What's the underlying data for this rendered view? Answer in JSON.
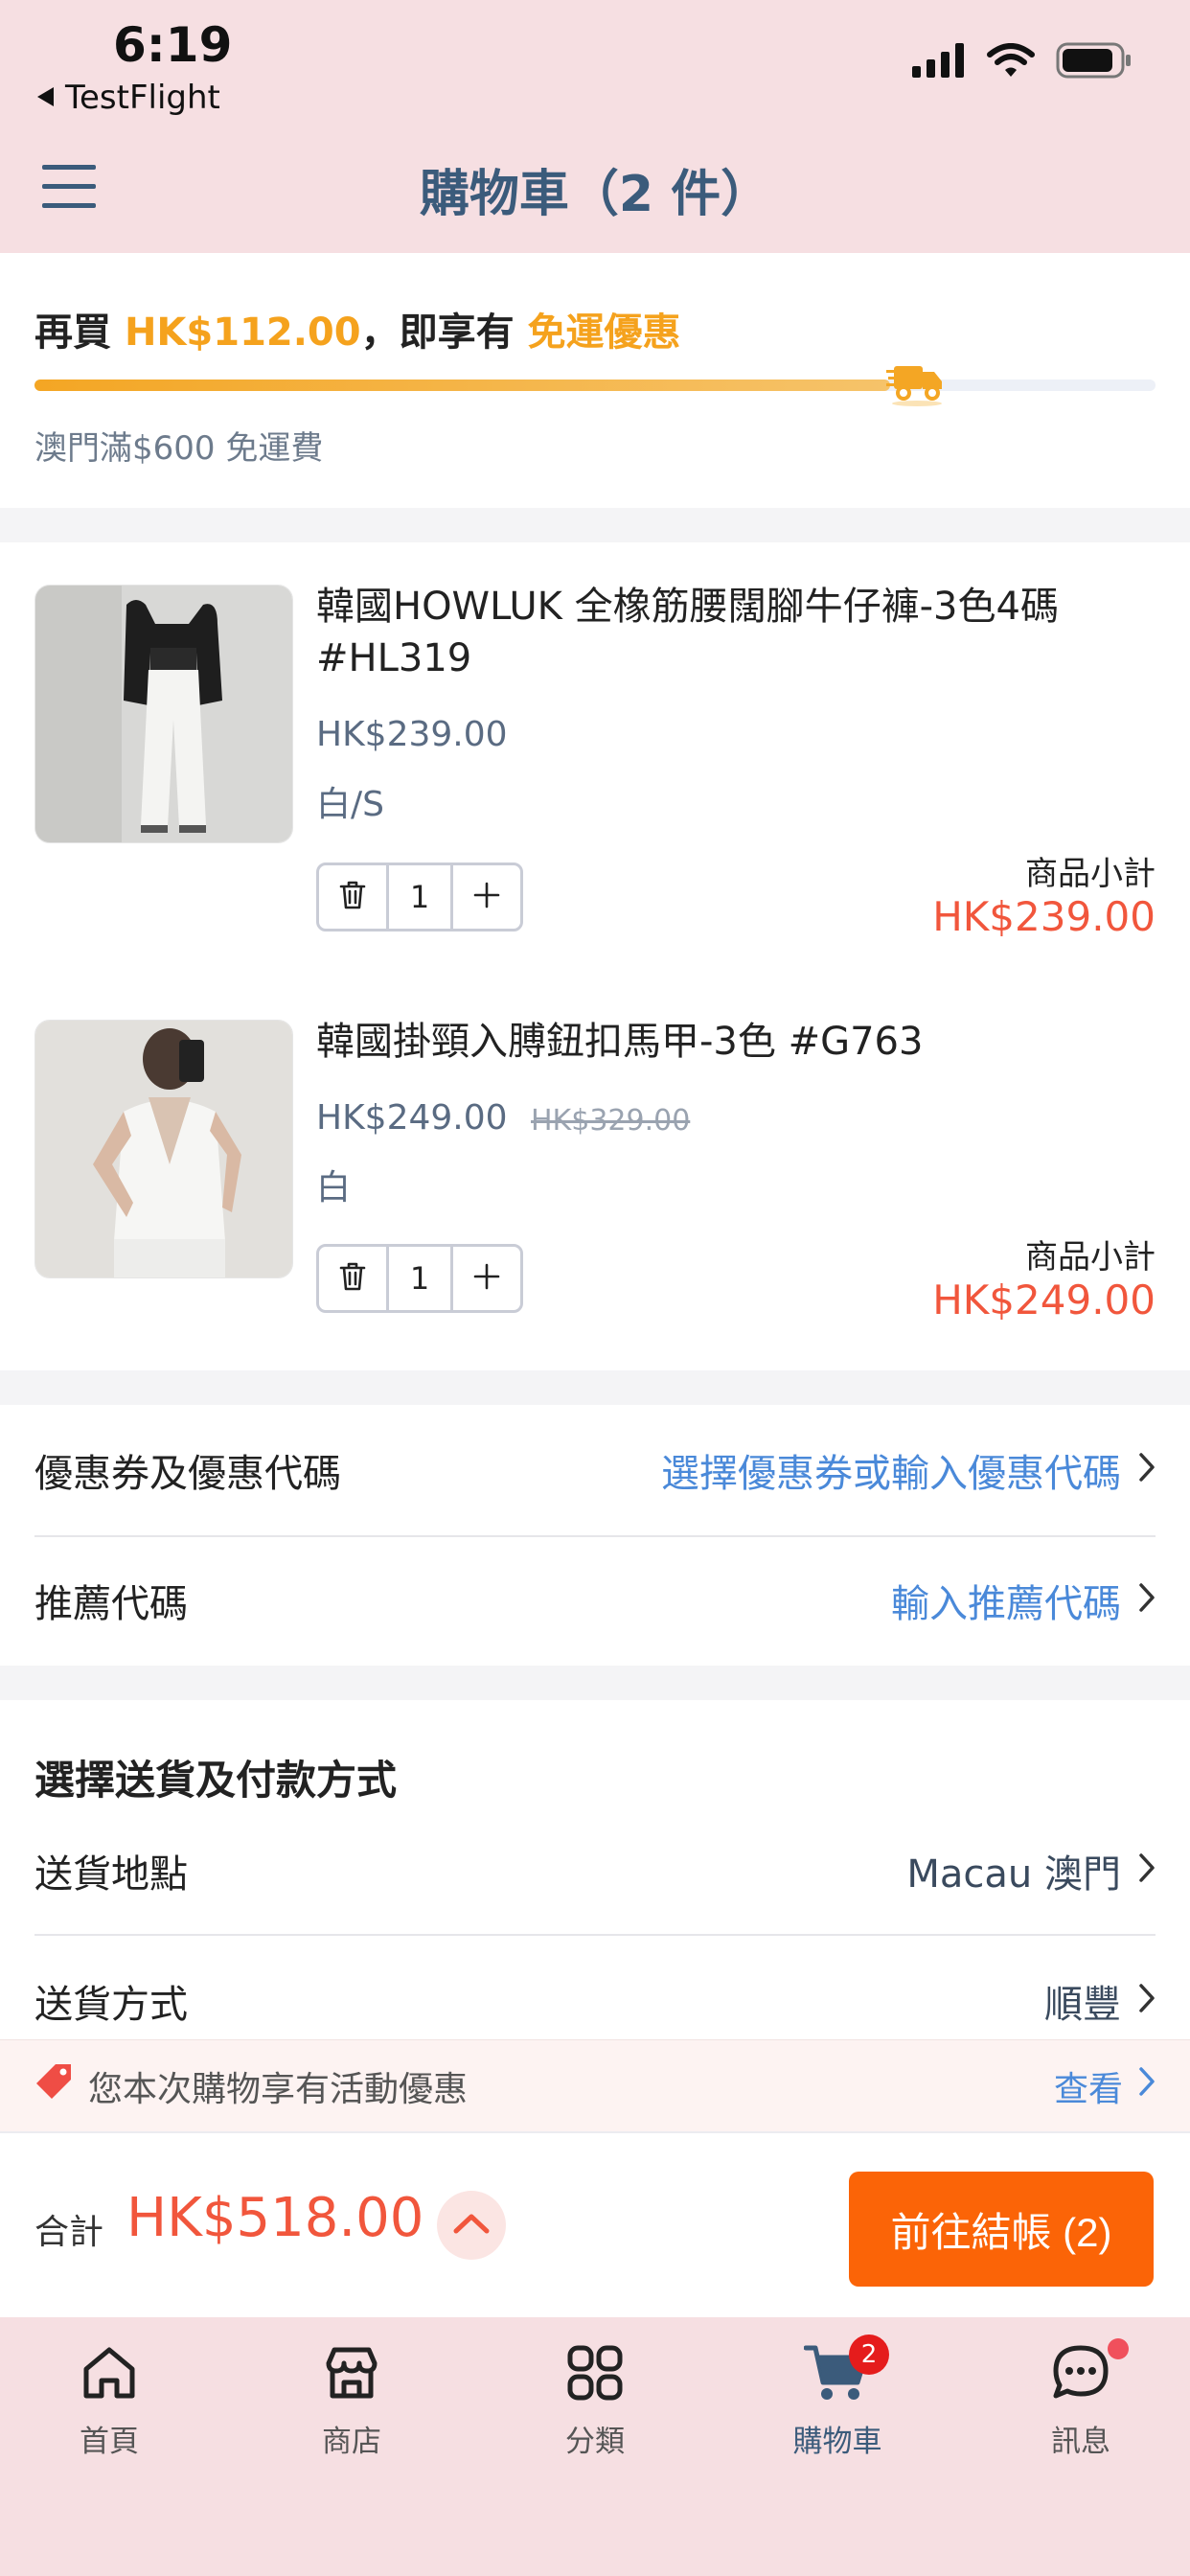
{
  "status_bar": {
    "time": "6:19",
    "back_app": "TestFlight"
  },
  "header": {
    "title": "購物車（2 件）"
  },
  "shipping": {
    "prefix": "再買 ",
    "amount": "HK$112.00",
    "middle": "，即享有 ",
    "benefit": "免運優惠",
    "note": "澳門滿$600 免運費",
    "progress_fraction": 0.7634
  },
  "items": [
    {
      "name": "韓國HOWLUK 全橡筋腰闊腳牛仔褲-3色4碼 #HL319",
      "price": "HK$239.00",
      "old_price": "",
      "variant": "白/S",
      "qty": "1",
      "subtotal_label": "商品小計",
      "subtotal": "HK$239.00"
    },
    {
      "name": "韓國掛頸入膊鈕扣馬甲-3色 #G763",
      "price": "HK$249.00",
      "old_price": "HK$329.00",
      "variant": "白",
      "qty": "1",
      "subtotal_label": "商品小計",
      "subtotal": "HK$249.00"
    }
  ],
  "coupons": {
    "coupon_label": "優惠券及優惠代碼",
    "coupon_action": "選擇優惠券或輸入優惠代碼",
    "referral_label": "推薦代碼",
    "referral_action": "輸入推薦代碼"
  },
  "delivery": {
    "title": "選擇送貨及付款方式",
    "location_label": "送貨地點",
    "location_value": "Macau 澳門",
    "method_label": "送貨方式",
    "method_value": "順豐"
  },
  "promo": {
    "text": "您本次購物享有活動優惠",
    "action": "查看"
  },
  "checkout": {
    "total_label": "合計",
    "total": "HK$518.00",
    "button": "前往結帳 (2)"
  },
  "tabbar": {
    "tabs": [
      {
        "label": "首頁",
        "icon": "home-icon"
      },
      {
        "label": "商店",
        "icon": "store-icon"
      },
      {
        "label": "分類",
        "icon": "category-icon"
      },
      {
        "label": "購物車",
        "icon": "cart-icon",
        "badge": "2"
      },
      {
        "label": "訊息",
        "icon": "chat-icon"
      }
    ]
  },
  "colors": {
    "accent_orange": "#f5a21d",
    "price_red": "#f1563c",
    "link_blue": "#4a89d9",
    "checkout_button": "#fb6407",
    "header_bg": "#f6dfe2"
  }
}
